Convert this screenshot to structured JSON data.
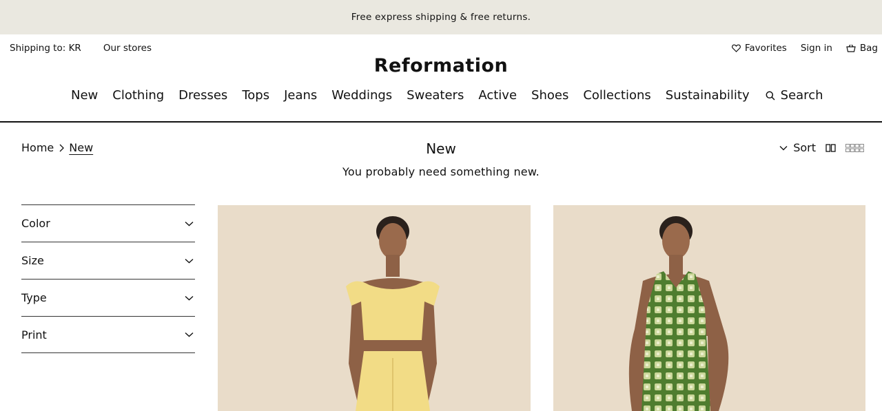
{
  "promo": {
    "text": "Free express shipping & free returns."
  },
  "utility": {
    "shipping": "Shipping to: KR",
    "stores": "Our stores",
    "favorites": "Favorites",
    "signin": "Sign in",
    "bag": "Bag"
  },
  "brand": "Reformation",
  "nav": {
    "items": [
      "New",
      "Clothing",
      "Dresses",
      "Tops",
      "Jeans",
      "Weddings",
      "Sweaters",
      "Active",
      "Shoes",
      "Collections",
      "Sustainability"
    ],
    "search": "Search"
  },
  "breadcrumb": {
    "home": "Home",
    "current": "New"
  },
  "page": {
    "title": "New",
    "subtitle": "You probably need something new."
  },
  "sort": {
    "label": "Sort"
  },
  "filters": [
    "Color",
    "Size",
    "Type",
    "Print"
  ],
  "colors": {
    "promo_bg": "#eae8e0",
    "photo_bg": "#e9dcc9",
    "yellow_outfit": "#f2dc86",
    "green_dress": "#4f7d2f"
  }
}
